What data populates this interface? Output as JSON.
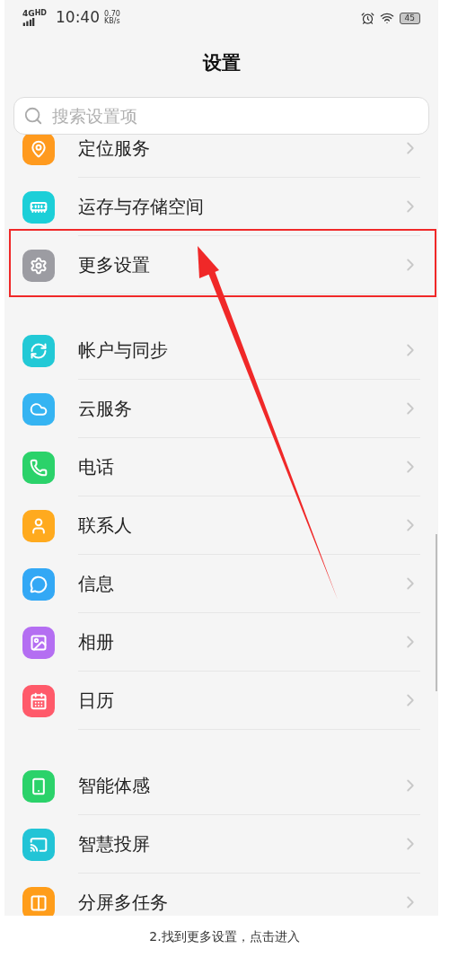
{
  "status_bar": {
    "network": "4G",
    "network_badge": "HD",
    "time": "10:40",
    "speed": "0.70",
    "speed_unit": "KB/s",
    "battery": "45"
  },
  "title": "设置",
  "search": {
    "placeholder": "搜索设置项"
  },
  "sections": [
    {
      "items": [
        {
          "label": "定位服务",
          "color": "#ff9a1e",
          "highlighted": false
        },
        {
          "label": "运存与存储空间",
          "color": "#1ccfd8",
          "highlighted": false
        },
        {
          "label": "更多设置",
          "color": "#9c9ca2",
          "highlighted": true
        }
      ]
    },
    {
      "items": [
        {
          "label": "帐户与同步",
          "color": "#22c9d6",
          "highlighted": false
        },
        {
          "label": "云服务",
          "color": "#35b4f2",
          "highlighted": false
        },
        {
          "label": "电话",
          "color": "#2bd26a",
          "highlighted": false
        },
        {
          "label": "联系人",
          "color": "#ffaa1e",
          "highlighted": false
        },
        {
          "label": "信息",
          "color": "#33a8f5",
          "highlighted": false
        },
        {
          "label": "相册",
          "color": "#b46ef2",
          "highlighted": false
        },
        {
          "label": "日历",
          "color": "#ff5a6a",
          "highlighted": false
        }
      ]
    },
    {
      "items": [
        {
          "label": "智能体感",
          "color": "#2bd26a",
          "highlighted": false
        },
        {
          "label": "智慧投屏",
          "color": "#22c4d6",
          "highlighted": false
        },
        {
          "label": "分屏多任务",
          "color": "#ff9d1a",
          "highlighted": false
        }
      ]
    }
  ],
  "caption": "2.找到更多设置，点击进入"
}
